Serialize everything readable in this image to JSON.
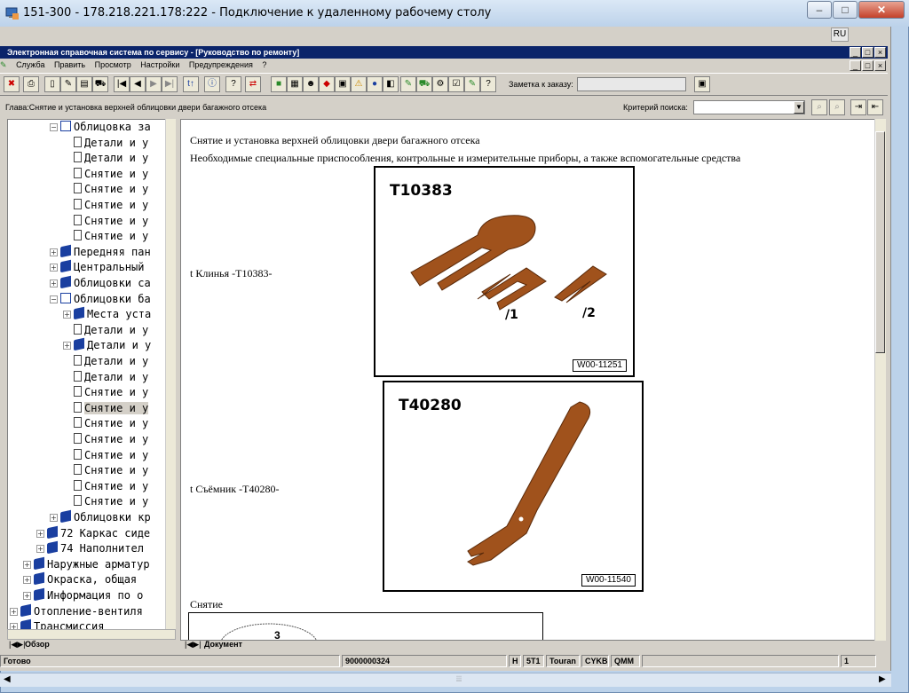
{
  "rdp": {
    "title": "151-300 - 178.218.221.178:222 - Подключение к удаленному рабочему столу",
    "lang": "RU"
  },
  "app": {
    "title": "Электронная справочная система по сервису - [Руководство по ремонту]"
  },
  "menu": [
    "Служба",
    "Править",
    "Просмотр",
    "Настройки",
    "Предупреждения",
    "?"
  ],
  "toolbar": {
    "zametka_label": "Заметка к заказу:",
    "zametka_value": ""
  },
  "breadcrumb": "Глава:Снятие и установка верхней облицовки двери багажного отсека",
  "search": {
    "label": "Критерий поиска:",
    "value": ""
  },
  "tree": [
    {
      "label": "Облицовка за",
      "type": "obook",
      "level": 3,
      "toggle": "−"
    },
    {
      "label": "Детали и у",
      "type": "doc",
      "level": 4
    },
    {
      "label": "Детали и у",
      "type": "doc",
      "level": 4
    },
    {
      "label": "Снятие и у",
      "type": "doc",
      "level": 4
    },
    {
      "label": "Снятие и у",
      "type": "doc",
      "level": 4
    },
    {
      "label": "Снятие и у",
      "type": "doc",
      "level": 4
    },
    {
      "label": "Снятие и у",
      "type": "doc",
      "level": 4
    },
    {
      "label": "Снятие и у",
      "type": "doc",
      "level": 4
    },
    {
      "label": "Передняя пан",
      "type": "book",
      "level": 3,
      "toggle": "+"
    },
    {
      "label": "Центральный",
      "type": "book",
      "level": 3,
      "toggle": "+"
    },
    {
      "label": "Облицовки са",
      "type": "book",
      "level": 3,
      "toggle": "+"
    },
    {
      "label": "Облицовки ба",
      "type": "obook",
      "level": 3,
      "toggle": "−"
    },
    {
      "label": "Места уста",
      "type": "book",
      "level": 4,
      "toggle": "+"
    },
    {
      "label": "Детали и у",
      "type": "doc",
      "level": 4
    },
    {
      "label": "Детали и у",
      "type": "book",
      "level": 4,
      "toggle": "+"
    },
    {
      "label": "Детали и у",
      "type": "doc",
      "level": 4
    },
    {
      "label": "Детали и у",
      "type": "doc",
      "level": 4
    },
    {
      "label": "Снятие и у",
      "type": "doc",
      "level": 4
    },
    {
      "label": "Снятие и у",
      "type": "doc",
      "level": 4,
      "selected": true
    },
    {
      "label": "Снятие и у",
      "type": "doc",
      "level": 4
    },
    {
      "label": "Снятие и у",
      "type": "doc",
      "level": 4
    },
    {
      "label": "Снятие и у",
      "type": "doc",
      "level": 4
    },
    {
      "label": "Снятие и у",
      "type": "doc",
      "level": 4
    },
    {
      "label": "Снятие и у",
      "type": "doc",
      "level": 4
    },
    {
      "label": "Снятие и у",
      "type": "doc",
      "level": 4
    },
    {
      "label": "Облицовки кр",
      "type": "book",
      "level": 3,
      "toggle": "+"
    },
    {
      "label": "72 Каркас сиде",
      "type": "book",
      "level": 2,
      "toggle": "+"
    },
    {
      "label": "74 Наполнител",
      "type": "book",
      "level": 2,
      "toggle": "+"
    },
    {
      "label": "Наружные арматур",
      "type": "book",
      "level": 1,
      "toggle": "+"
    },
    {
      "label": "Окраска, общая",
      "type": "book",
      "level": 1,
      "toggle": "+"
    },
    {
      "label": "Информация по о",
      "type": "book",
      "level": 1,
      "toggle": "+"
    },
    {
      "label": "Отопление-вентиля",
      "type": "book",
      "level": 0,
      "toggle": "+"
    },
    {
      "label": "Трансмиссия",
      "type": "book",
      "level": 0,
      "toggle": "+"
    }
  ],
  "tabs": {
    "left": "Обзор",
    "right": "Документ"
  },
  "document": {
    "heading": "Снятие и установка верхней облицовки двери багажного отсека",
    "subheading": "Необходимые специальные приспособления, контрольные и измерительные приборы, а также вспомогательные средства",
    "tool1": {
      "caption": "t  Клинья -T10383-",
      "figure_title": "T10383",
      "code": "W00-11251",
      "labels": [
        "/1",
        "/2"
      ]
    },
    "tool2": {
      "caption": "t  Съёмник -T40280-",
      "figure_title": "T40280",
      "code": "W00-11540"
    },
    "section": "Снятие",
    "fig3_label": "3"
  },
  "status": {
    "text": "Готово",
    "doc_id": "9000000324",
    "c1": "H",
    "c2": "5T1",
    "c3": "Touran",
    "c4": "CYKB",
    "c5": "QMM",
    "page": "1"
  },
  "colors": {
    "tool": "#a0521c",
    "title_bar": "#0a246a",
    "book": "#1a3fa0"
  }
}
